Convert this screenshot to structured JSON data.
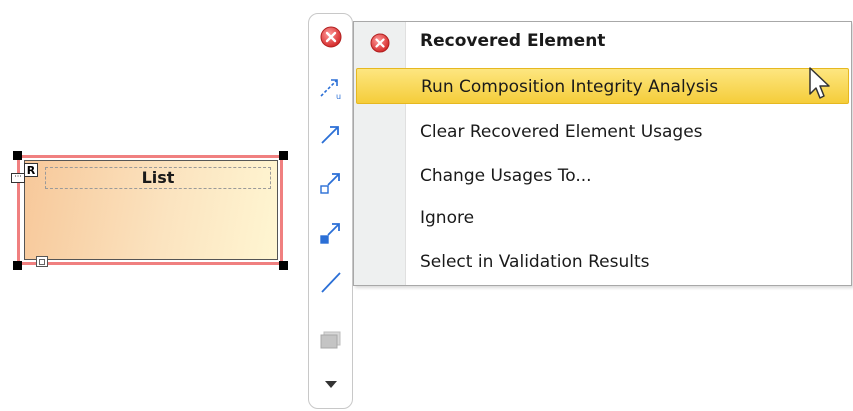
{
  "element": {
    "name": "List",
    "badge": "R"
  },
  "toolbar": {
    "buttons": [
      {
        "icon": "close-icon"
      },
      {
        "icon": "usage-dependency-icon"
      },
      {
        "icon": "directed-association-icon"
      },
      {
        "icon": "aggregation-icon"
      },
      {
        "icon": "composition-icon"
      },
      {
        "icon": "association-icon"
      },
      {
        "icon": "image-icon"
      },
      {
        "icon": "more-down-icon"
      }
    ]
  },
  "menu": {
    "header": "Recovered Element",
    "items": [
      {
        "label": "Run Composition Integrity Analysis",
        "highlighted": true
      },
      {
        "label": "Clear Recovered Element Usages",
        "highlighted": false
      },
      {
        "label": "Change Usages To...",
        "highlighted": false
      },
      {
        "label": "Ignore",
        "highlighted": false
      },
      {
        "label": "Select in Validation Results",
        "highlighted": false
      }
    ]
  },
  "colors": {
    "close_red": "#e04040",
    "link_blue": "#2b6fd6",
    "highlight": "#f5cd3a",
    "selection_border": "#f08080"
  }
}
